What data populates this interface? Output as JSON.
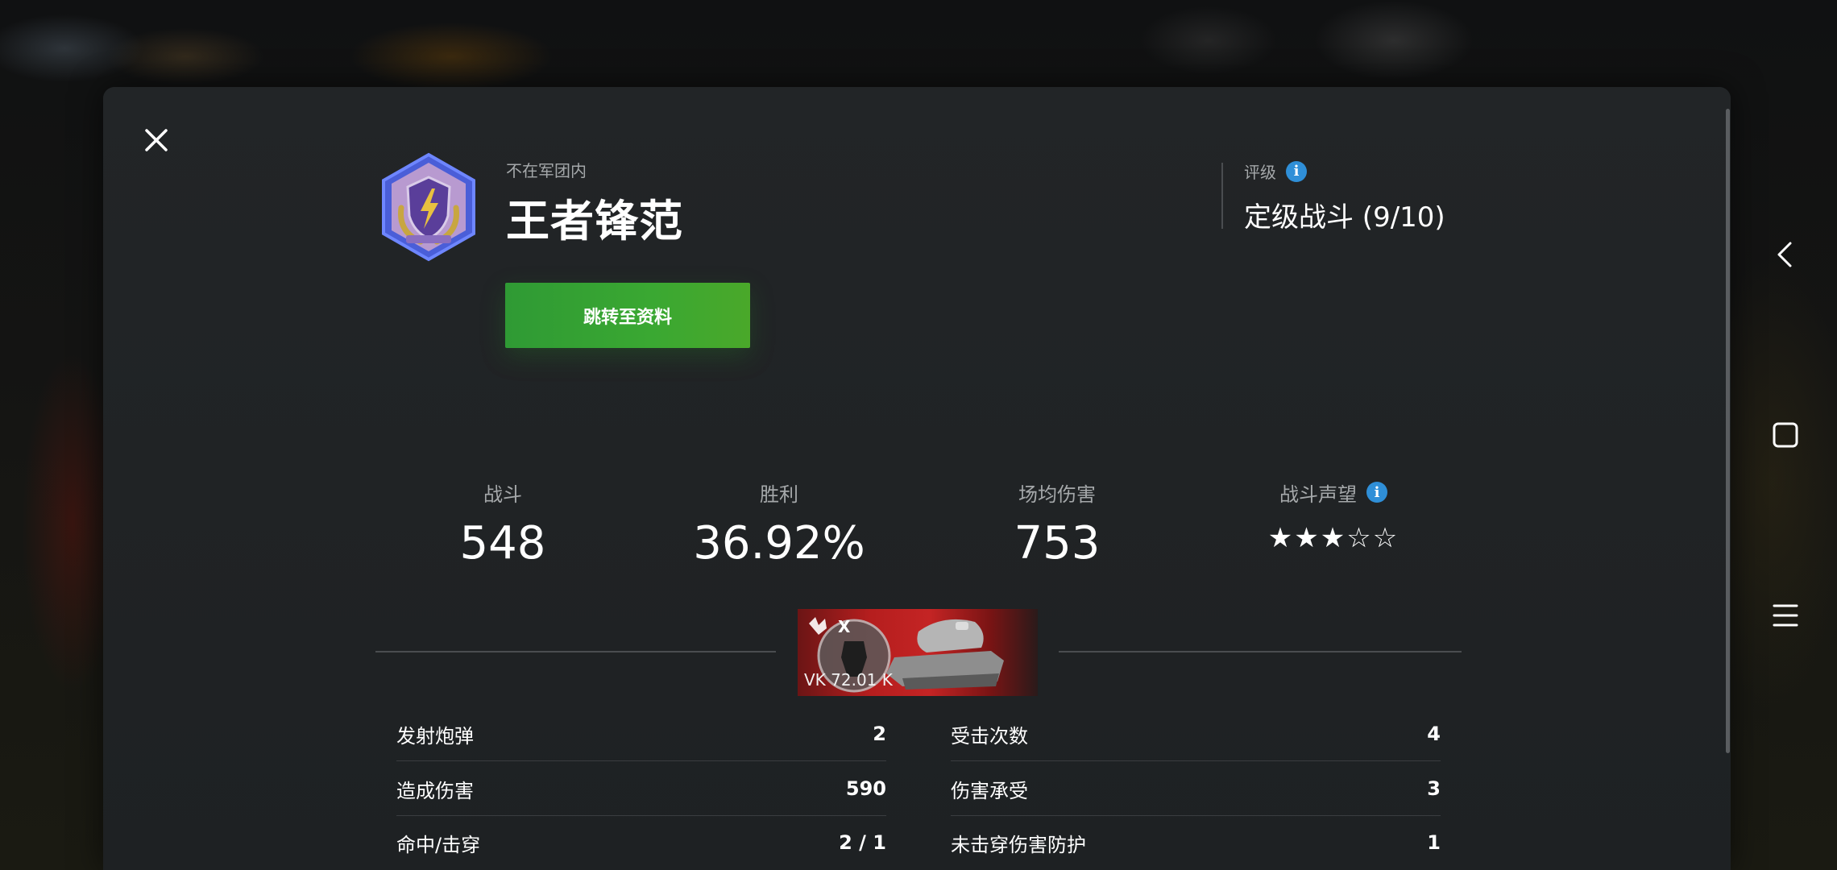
{
  "header": {
    "clan_status": "不在军团内",
    "player_name": "王者锋范",
    "profile_button": "跳转至资料",
    "rating_label": "评级",
    "rating_value": "定级战斗 (9/10)"
  },
  "stats": [
    {
      "label": "战斗",
      "value": "548"
    },
    {
      "label": "胜利",
      "value": "36.92%"
    },
    {
      "label": "场均伤害",
      "value": "753"
    },
    {
      "label": "战斗声望",
      "value": "★★★☆☆",
      "stars": 3,
      "max_stars": 5
    }
  ],
  "tank": {
    "tier": "X",
    "name": "VK 72.01 K"
  },
  "details_left": [
    {
      "label": "发射炮弹",
      "value": "2"
    },
    {
      "label": "造成伤害",
      "value": "590"
    },
    {
      "label": "命中/击穿",
      "value": "2 / 1"
    }
  ],
  "details_right": [
    {
      "label": "受击次数",
      "value": "4"
    },
    {
      "label": "伤害承受",
      "value": "3"
    },
    {
      "label": "未击穿伤害防护",
      "value": "1"
    }
  ],
  "icons": {
    "close": "close-icon",
    "info": "info-icon",
    "back": "back-icon",
    "home": "home-icon",
    "menu": "menu-icon"
  },
  "colors": {
    "panel": "#222527",
    "accent_green": "#3aa832",
    "info_blue": "#2f8fd8",
    "tank_red": "#c42424"
  }
}
